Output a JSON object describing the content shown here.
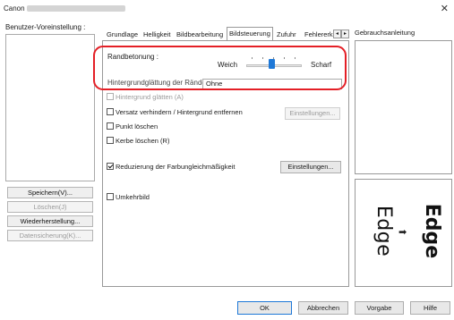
{
  "window": {
    "title": "Canon",
    "close_label": "✕"
  },
  "left": {
    "label": "Benutzer-Voreinstellung :",
    "buttons": [
      {
        "label": "Speichern(V)...",
        "enabled": true
      },
      {
        "label": "Löschen(J)",
        "enabled": false
      },
      {
        "label": "Wiederherstellung...",
        "enabled": true
      },
      {
        "label": "Datensicherung(K)...",
        "enabled": false
      }
    ]
  },
  "tabs": [
    {
      "label": "Grundlage",
      "active": false
    },
    {
      "label": "Helligkeit",
      "active": false
    },
    {
      "label": "Bildbearbeitung",
      "active": false
    },
    {
      "label": "Bildsteuerung",
      "active": true
    },
    {
      "label": "Zufuhr",
      "active": false
    },
    {
      "label": "Fehlererk",
      "active": false
    }
  ],
  "tab_nav": {
    "prev": "◂",
    "next": "▸"
  },
  "edge": {
    "label": "Randbetonung :",
    "min_label": "Weich",
    "max_label": "Scharf",
    "level": 0.45
  },
  "cut_text": "Hintergrundglättung der Ränder",
  "combo_value": "Ohne",
  "options": [
    {
      "label": "Hintergrund glätten (A)",
      "checked": false,
      "enabled": false
    },
    {
      "label": "Versatz verhindern / Hintergrund entfernen",
      "checked": false,
      "enabled": true
    },
    {
      "label": "Punkt löschen",
      "checked": false,
      "enabled": true
    },
    {
      "label": "Kerbe löschen (R)",
      "checked": false,
      "enabled": true
    },
    {
      "label": "Reduzierung der Farbungleichmäßigkeit",
      "checked": true,
      "enabled": true
    },
    {
      "label": "Umkehrbild",
      "checked": false,
      "enabled": true
    }
  ],
  "settings_buttons": [
    {
      "label": "Einstellungen...",
      "enabled": false
    },
    {
      "label": "Einstellungen...",
      "enabled": true
    }
  ],
  "help": {
    "label": "Gebrauchsanleitung"
  },
  "preview": {
    "word": "Edge",
    "arrow": "➡"
  },
  "footer": {
    "ok": "OK",
    "cancel": "Abbrechen",
    "default": "Vorgabe",
    "help": "Hilfe"
  },
  "colors": {
    "highlight": "#e41f26",
    "slider_thumb": "#1e78d7"
  }
}
